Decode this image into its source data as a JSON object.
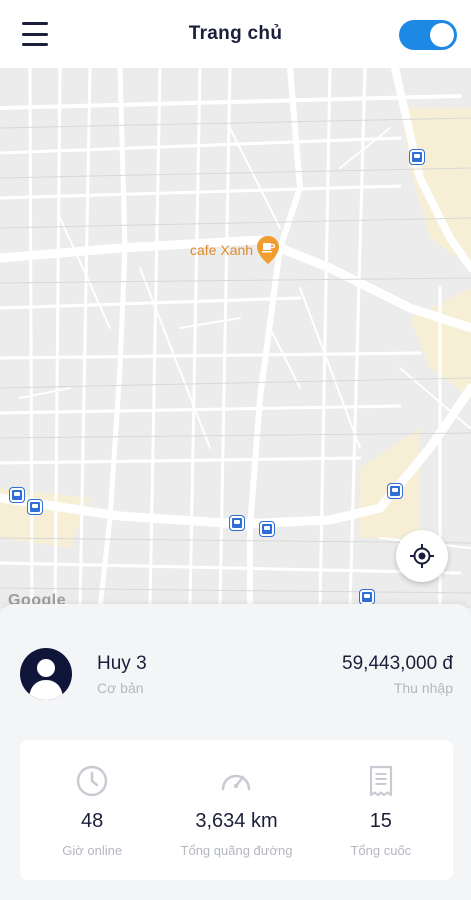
{
  "header": {
    "title": "Trang chủ",
    "online_toggle": {
      "state": "on",
      "color": "#1e88e5"
    }
  },
  "map": {
    "poi_label": "cafe Xanh",
    "attribution": "Google"
  },
  "driver": {
    "name": "Huy 3",
    "tier": "Cơ bản",
    "income_value": "59,443,000 đ",
    "income_label": "Thu nhập"
  },
  "stats": [
    {
      "icon": "clock-icon",
      "value": "48",
      "label": "Giờ online"
    },
    {
      "icon": "speedometer-icon",
      "value": "3,634 km",
      "label": "Tổng quãng đường"
    },
    {
      "icon": "receipt-icon",
      "value": "15",
      "label": "Tổng cuốc"
    }
  ],
  "colors": {
    "primary_text": "#1b1f3b",
    "muted_text": "#b4b7c0",
    "accent": "#1e88e5",
    "poi": "#e08a2c"
  }
}
